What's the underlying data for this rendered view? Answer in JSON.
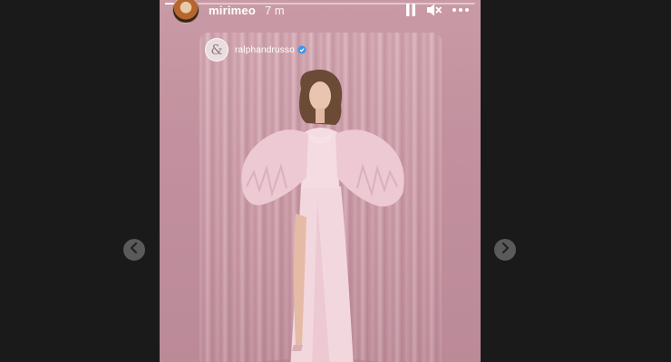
{
  "story": {
    "username": "mirimeo",
    "time_ago": "7 m",
    "progress": 0.05
  },
  "controls": {
    "pause_icon": "pause-icon",
    "mute_icon": "muted-speaker-icon",
    "more_icon": "more-options-icon"
  },
  "repost": {
    "account": "ralphandrusso",
    "avatar_glyph": "&",
    "verified_color": "#3897f0"
  },
  "colors": {
    "background": "#1a1a1a",
    "story_pink": "#c2909e",
    "dress_pink": "#f3d7df"
  }
}
